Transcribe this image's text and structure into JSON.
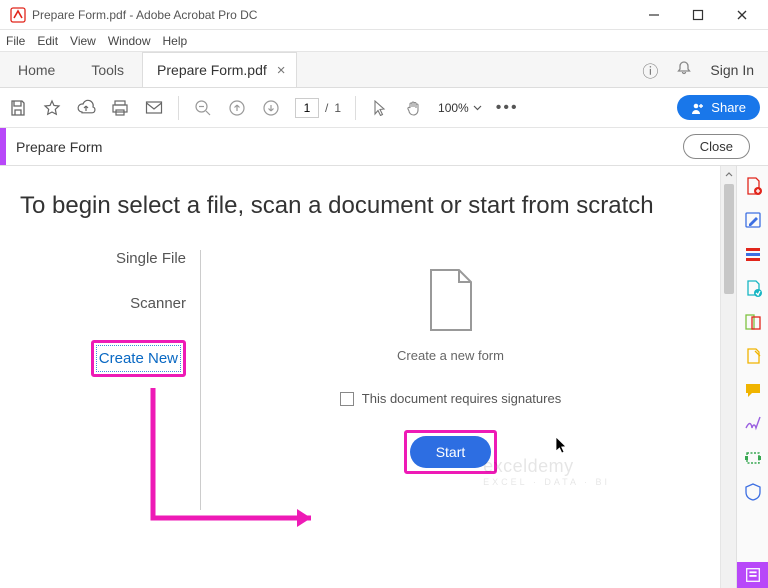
{
  "window": {
    "title": "Prepare Form.pdf - Adobe Acrobat Pro DC"
  },
  "menubar": [
    "File",
    "Edit",
    "View",
    "Window",
    "Help"
  ],
  "tabs": {
    "home": "Home",
    "tools": "Tools",
    "file": "Prepare Form.pdf",
    "signin": "Sign In"
  },
  "toolbar": {
    "page_current": "1",
    "page_sep": "/",
    "page_total": "1",
    "zoom": "100%",
    "share": "Share"
  },
  "contextbar": {
    "label": "Prepare Form",
    "close": "Close"
  },
  "main": {
    "headline": "To begin select a file, scan a document or start from scratch",
    "options": {
      "single_file": "Single File",
      "scanner": "Scanner",
      "create_new": "Create New"
    },
    "caption": "Create a new form",
    "checkbox_label": "This document requires signatures",
    "start": "Start"
  },
  "watermark": {
    "line1": "exceldemy",
    "line2": "EXCEL · DATA · BI"
  }
}
